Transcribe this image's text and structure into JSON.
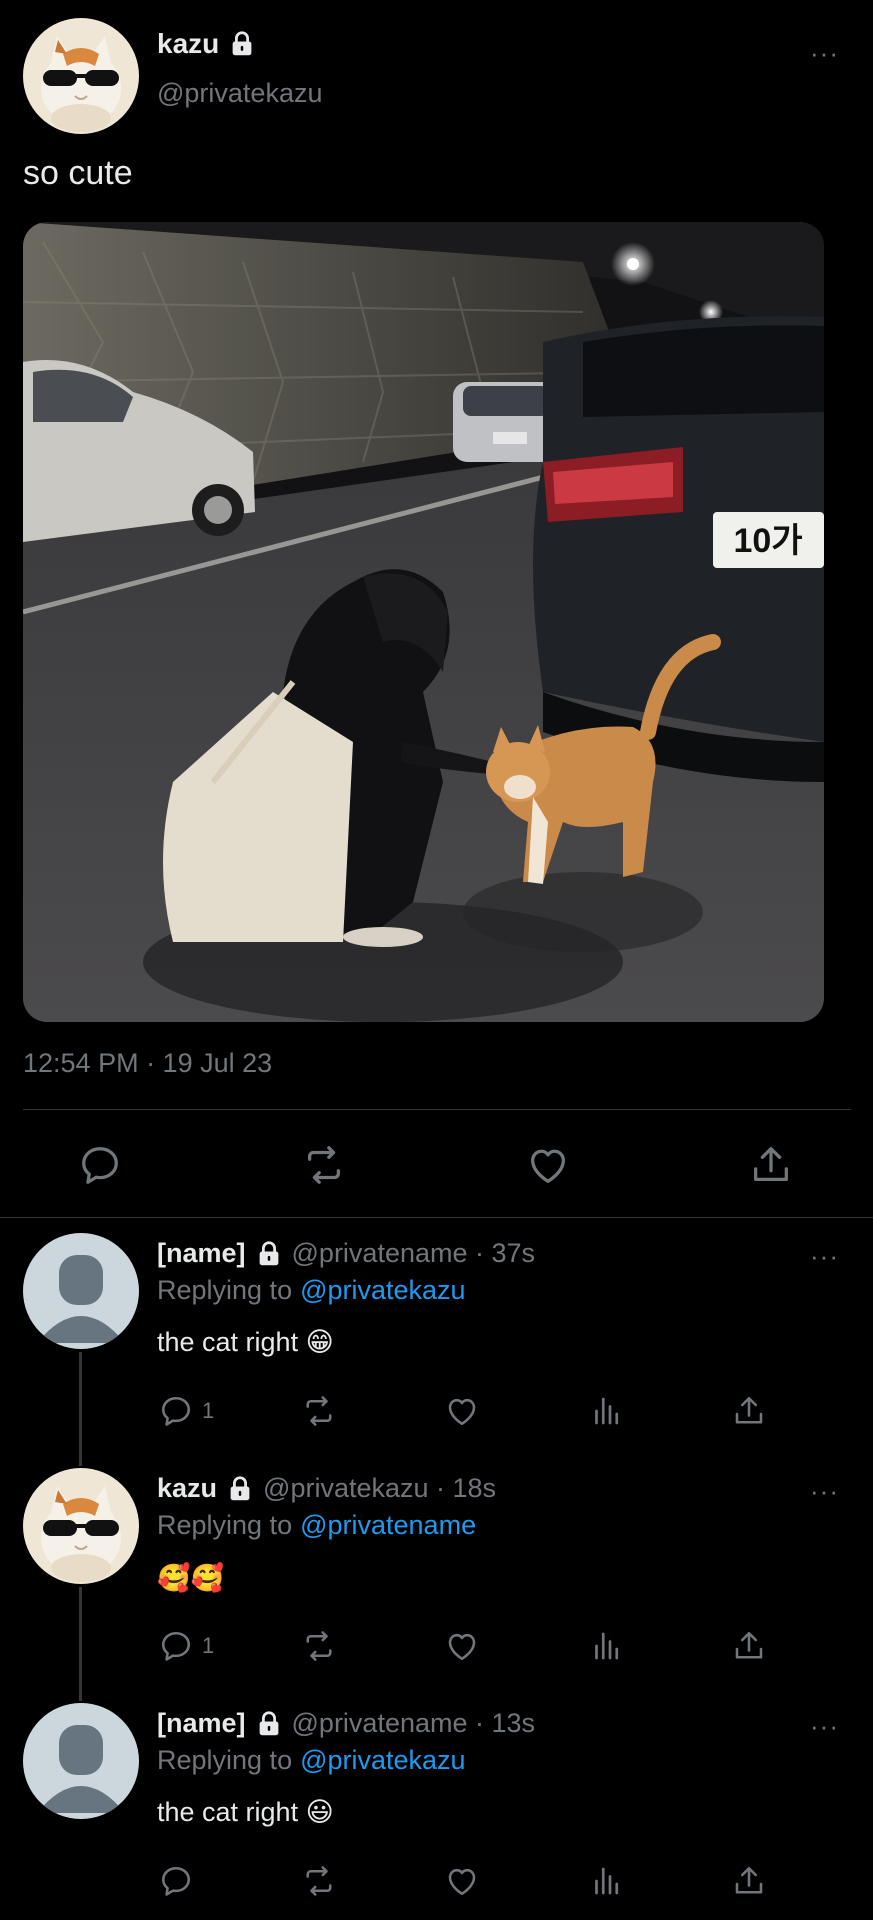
{
  "main_tweet": {
    "display_name": "kazu",
    "handle": "@privatekazu",
    "text": "so cute",
    "timestamp": "12:54 PM · 19 Jul 23",
    "more_label": "···"
  },
  "replies": [
    {
      "display_name": "[name]",
      "handle_time": "@privatename · 37s",
      "replying_prefix": "Replying to",
      "replying_to": "@privatekazu",
      "text": "the cat right 😁",
      "reply_count": "1",
      "more_label": "···"
    },
    {
      "display_name": "kazu",
      "handle_time": "@privatekazu · 18s",
      "replying_prefix": "Replying to",
      "replying_to": "@privatename",
      "text": "🥰🥰",
      "reply_count": "1",
      "more_label": "···"
    },
    {
      "display_name": "[name]",
      "handle_time": "@privatename · 13s",
      "replying_prefix": "Replying to",
      "replying_to": "@privatekazu",
      "text": "the cat right 😃",
      "reply_count": "",
      "more_label": "···"
    }
  ],
  "colors": {
    "background": "#000000",
    "text": "#e7e9ea",
    "secondary": "#71767b",
    "link": "#1d9bf0",
    "divider": "#2f3336"
  },
  "icons": [
    "lock-icon",
    "reply-icon",
    "retweet-icon",
    "like-icon",
    "share-icon",
    "analytics-icon",
    "more-icon"
  ]
}
